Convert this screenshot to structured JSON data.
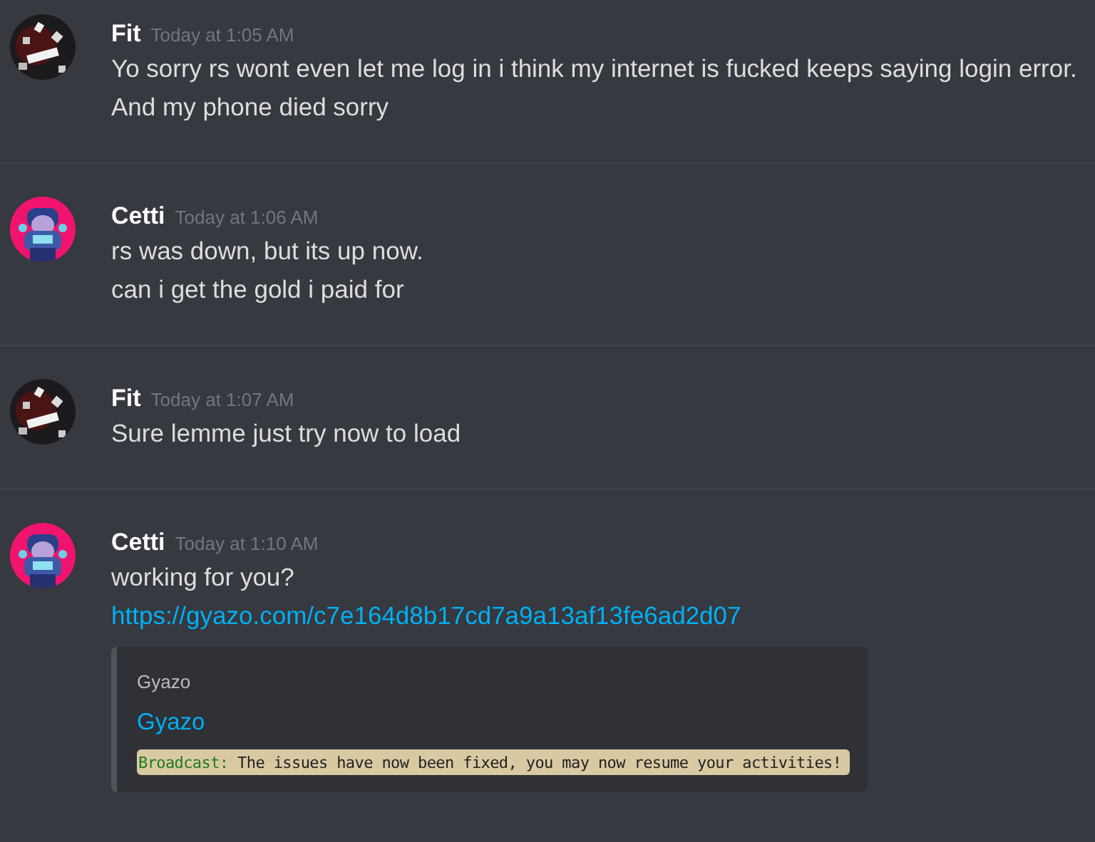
{
  "messages": [
    {
      "author": "Fit",
      "avatar": {
        "kind": "dark"
      },
      "timestamp": "Today at 1:05 AM",
      "lines": [
        "Yo sorry rs wont even let me log in i think my internet is fucked keeps saying login error.",
        "And my phone died sorry"
      ]
    },
    {
      "author": "Cetti",
      "avatar": {
        "kind": "pink"
      },
      "timestamp": "Today at 1:06 AM",
      "lines": [
        "rs was down, but its up now.",
        "can i get the gold i paid for"
      ]
    },
    {
      "author": "Fit",
      "avatar": {
        "kind": "dark"
      },
      "timestamp": "Today at 1:07 AM",
      "lines": [
        "Sure lemme just try now to load"
      ]
    },
    {
      "author": "Cetti",
      "avatar": {
        "kind": "pink"
      },
      "timestamp": "Today at 1:10 AM",
      "lines": [
        "working for you?"
      ],
      "link": "https://gyazo.com/c7e164d8b17cd7a9a13af13fe6ad2d07",
      "embed": {
        "provider": "Gyazo",
        "title": "Gyazo",
        "image": {
          "prefix": "Broadcast:",
          "text": " The issues have now been fixed, you may now resume your activities!"
        }
      }
    }
  ]
}
